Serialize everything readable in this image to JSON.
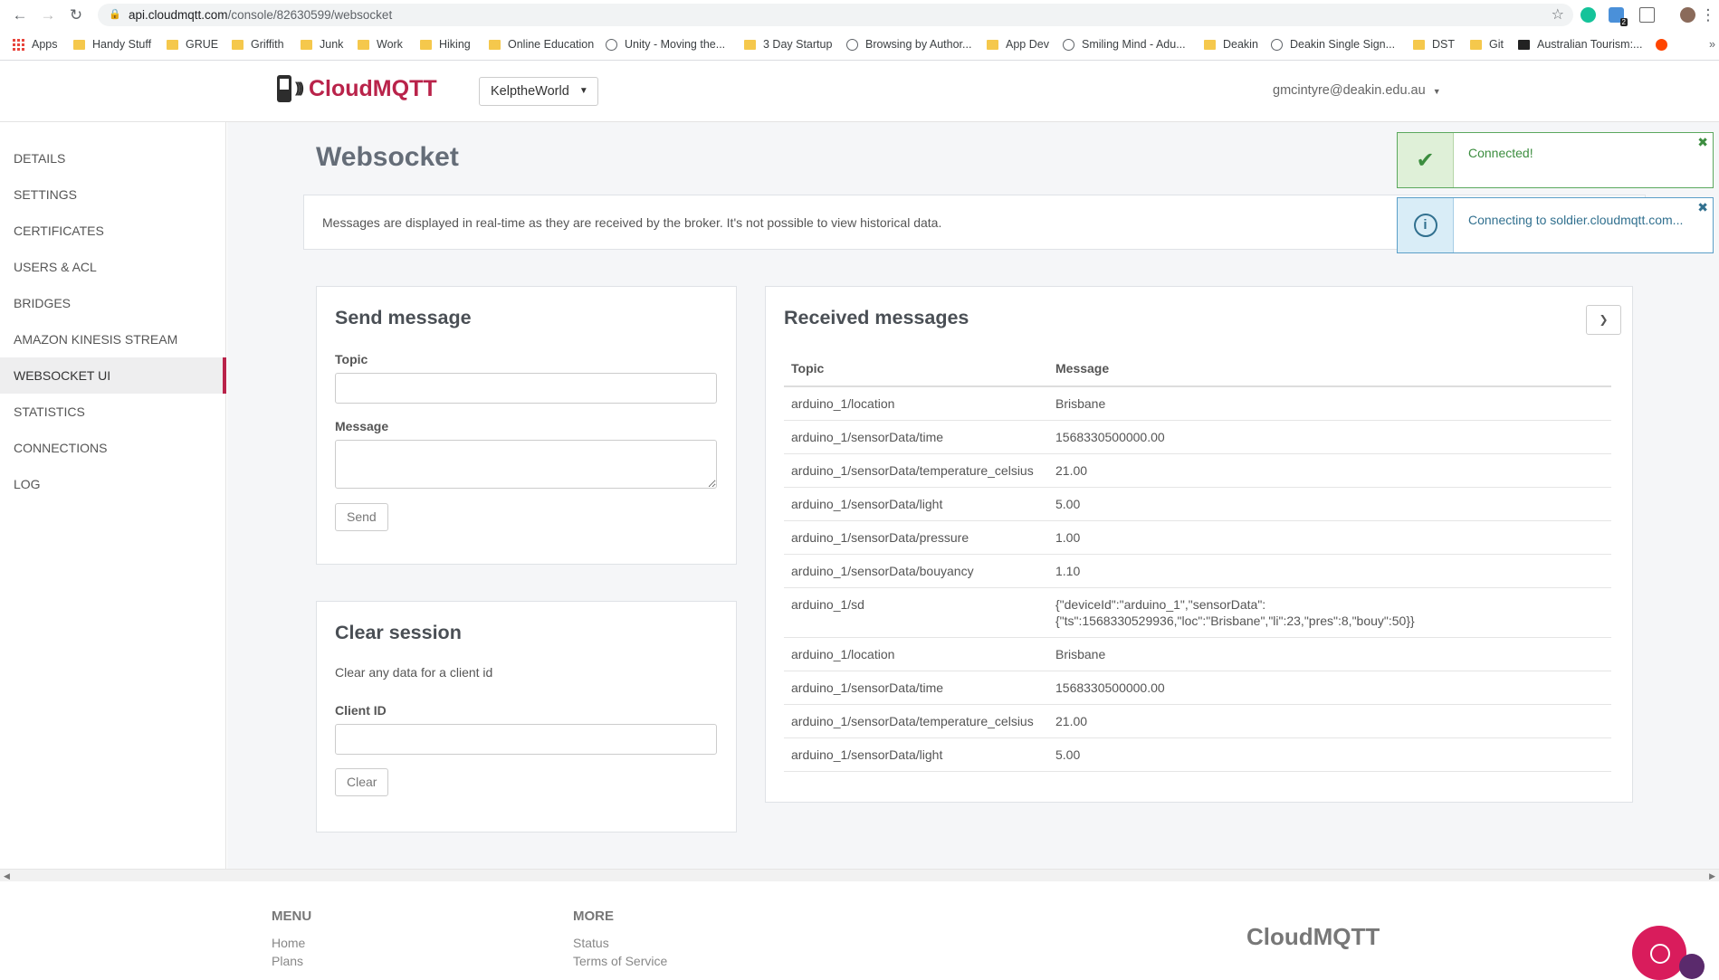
{
  "browser": {
    "url_host": "api.cloudmqtt.com",
    "url_path": "/console/82630599/websocket",
    "ext_badge": "2",
    "bookmarks": [
      "Apps",
      "Handy Stuff",
      "GRUE",
      "Griffith",
      "Junk",
      "Work",
      "Hiking",
      "Online Education",
      "Unity - Moving the...",
      "3 Day Startup",
      "Browsing by Author...",
      "App Dev",
      "Smiling Mind - Adu...",
      "Deakin",
      "Deakin Single Sign...",
      "DST",
      "Git",
      "Australian Tourism:..."
    ]
  },
  "header": {
    "logo": "CloudMQTT",
    "instance": "KelptheWorld",
    "user": "gmcintyre@deakin.edu.au"
  },
  "sidebar": {
    "items": [
      {
        "label": "DETAILS"
      },
      {
        "label": "SETTINGS"
      },
      {
        "label": "CERTIFICATES"
      },
      {
        "label": "USERS & ACL"
      },
      {
        "label": "BRIDGES"
      },
      {
        "label": "AMAZON KINESIS STREAM"
      },
      {
        "label": "WEBSOCKET UI"
      },
      {
        "label": "STATISTICS"
      },
      {
        "label": "CONNECTIONS"
      },
      {
        "label": "LOG"
      }
    ],
    "active": "WEBSOCKET UI"
  },
  "main": {
    "title": "Websocket",
    "info": "Messages are displayed in real-time as they are received by the broker. It's not possible to view historical data."
  },
  "send": {
    "title": "Send message",
    "topic_label": "Topic",
    "topic_value": "",
    "message_label": "Message",
    "message_value": "",
    "button": "Send"
  },
  "clear": {
    "title": "Clear session",
    "desc": "Clear any data for a client id",
    "client_label": "Client ID",
    "client_value": "",
    "button": "Clear"
  },
  "received": {
    "title": "Received messages",
    "columns": [
      "Topic",
      "Message"
    ],
    "rows": [
      [
        "arduino_1/location",
        "Brisbane"
      ],
      [
        "arduino_1/sensorData/time",
        "1568330500000.00"
      ],
      [
        "arduino_1/sensorData/temperature_celsius",
        "21.00"
      ],
      [
        "arduino_1/sensorData/light",
        "5.00"
      ],
      [
        "arduino_1/sensorData/pressure",
        "1.00"
      ],
      [
        "arduino_1/sensorData/bouyancy",
        "1.10"
      ],
      [
        "arduino_1/sd",
        "{\"deviceId\":\"arduino_1\",\"sensorData\":\n{\"ts\":1568330529936,\"loc\":\"Brisbane\",\"li\":23,\"pres\":8,\"bouy\":50}}"
      ],
      [
        "arduino_1/location",
        "Brisbane"
      ],
      [
        "arduino_1/sensorData/time",
        "1568330500000.00"
      ],
      [
        "arduino_1/sensorData/temperature_celsius",
        "21.00"
      ],
      [
        "arduino_1/sensorData/light",
        "5.00"
      ]
    ]
  },
  "toasts": [
    {
      "text": "Connected!",
      "type": "success"
    },
    {
      "text": "Connecting to soldier.cloudmqtt.com...",
      "type": "info"
    }
  ],
  "footer": {
    "menu_title": "MENU",
    "menu_links": [
      "Home",
      "Plans"
    ],
    "more_title": "MORE",
    "more_links": [
      "Status",
      "Terms of Service"
    ],
    "logo": "CloudMQTT"
  }
}
